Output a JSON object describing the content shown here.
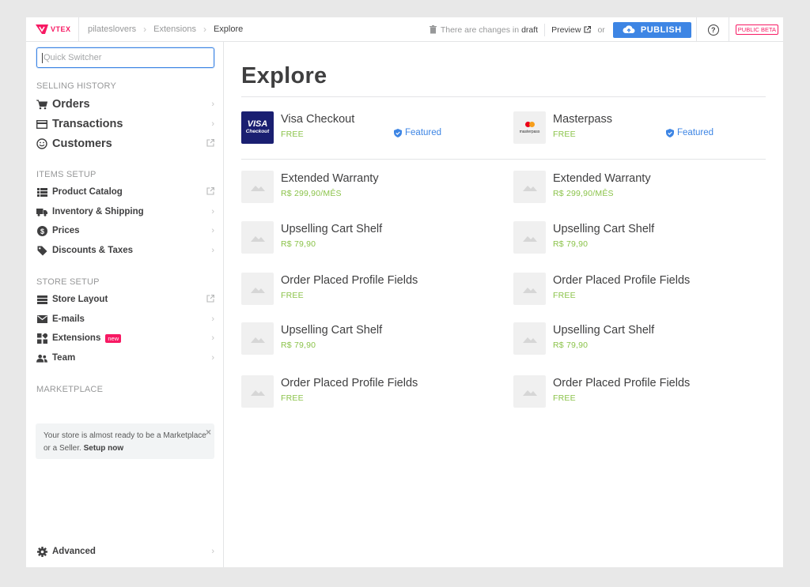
{
  "topbar": {
    "logo_text": "VTEX",
    "breadcrumbs": [
      "pilateslovers",
      "Extensions",
      "Explore"
    ],
    "changes_text": "There are changes in",
    "changes_state": "draft",
    "preview_label": "Preview",
    "or_label": "or",
    "publish_label": "PUBLISH",
    "help_label": "?",
    "beta_label": "PUBLIC BETA"
  },
  "sidebar": {
    "quick_switcher_placeholder": "Quick Switcher",
    "sections": {
      "selling_history": "SELLING HISTORY",
      "items_setup": "ITEMS SETUP",
      "store_setup": "STORE SETUP",
      "marketplace": "MARKETPLACE"
    },
    "selling": [
      {
        "label": "Orders",
        "icon": "cart-icon"
      },
      {
        "label": "Transactions",
        "icon": "card-icon"
      },
      {
        "label": "Customers",
        "icon": "smile-icon"
      }
    ],
    "items": [
      {
        "label": "Product Catalog",
        "icon": "list-icon"
      },
      {
        "label": "Inventory & Shipping",
        "icon": "truck-icon"
      },
      {
        "label": "Prices",
        "icon": "dollar-icon"
      },
      {
        "label": "Discounts & Taxes",
        "icon": "tag-icon"
      }
    ],
    "store": [
      {
        "label": "Store Layout",
        "icon": "layout-icon"
      },
      {
        "label": "E-mails",
        "icon": "mail-icon"
      },
      {
        "label": "Extensions",
        "icon": "extensions-icon",
        "badge": "new"
      },
      {
        "label": "Team",
        "icon": "team-icon"
      }
    ],
    "marketplace_text": "Your store is almost ready to be a Marketplace or a Seller.",
    "marketplace_link": "Setup now",
    "marketplace_close": "×",
    "advanced_label": "Advanced"
  },
  "main": {
    "title": "Explore",
    "featured": [
      {
        "name": "Visa Checkout",
        "price": "FREE",
        "badge": "Featured",
        "logo": "visa-logo",
        "logo_text_1": "VISA",
        "logo_text_2": "Checkout"
      },
      {
        "name": "Masterpass",
        "price": "FREE",
        "badge": "Featured",
        "logo": "masterpass-logo",
        "logo_text": "masterpass"
      }
    ],
    "apps": [
      {
        "name": "Extended Warranty",
        "price": "R$ 299,90/MÊS"
      },
      {
        "name": "Extended Warranty",
        "price": "R$ 299,90/MÊS"
      },
      {
        "name": "Upselling Cart Shelf",
        "price": "R$ 79,90"
      },
      {
        "name": "Upselling Cart Shelf",
        "price": "R$ 79,90"
      },
      {
        "name": "Order Placed Profile Fields",
        "price": "FREE"
      },
      {
        "name": "Order Placed Profile Fields",
        "price": "FREE"
      },
      {
        "name": "Upselling Cart Shelf",
        "price": "R$ 79,90"
      },
      {
        "name": "Upselling Cart Shelf",
        "price": "R$ 79,90"
      },
      {
        "name": "Order Placed Profile Fields",
        "price": "FREE"
      },
      {
        "name": "Order Placed Profile Fields",
        "price": "FREE"
      }
    ]
  },
  "colors": {
    "brand": "#f71963",
    "accent": "#3d85e4",
    "price_green": "#8bc34a"
  }
}
